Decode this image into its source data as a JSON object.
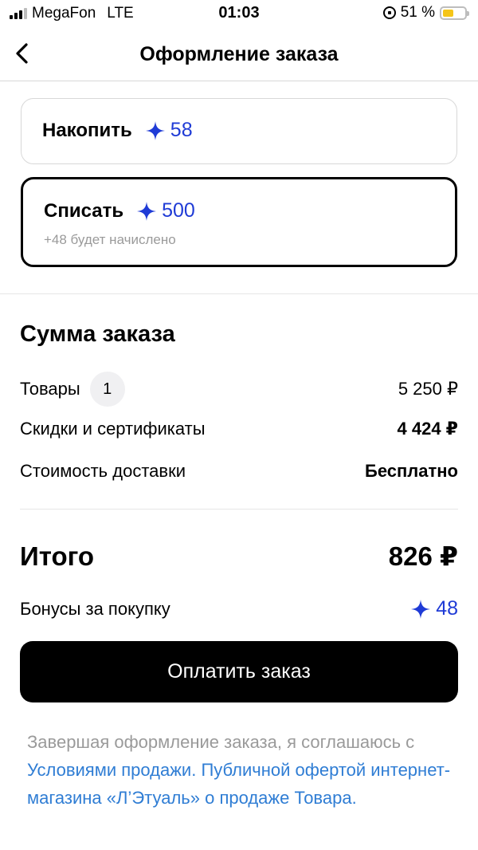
{
  "status_bar": {
    "carrier": "MegaFon",
    "network": "LTE",
    "time": "01:03",
    "battery": "51 %",
    "battery_level": 0.51
  },
  "header": {
    "title": "Оформление заказа",
    "back_icon": "chevron-left-icon"
  },
  "bonus_options": {
    "accumulate": {
      "label": "Накопить",
      "amount": "58"
    },
    "spend": {
      "label": "Списать",
      "amount": "500",
      "note": "+48 будет начислено",
      "selected": true
    }
  },
  "summary": {
    "title": "Сумма заказа",
    "goods_label": "Товары",
    "goods_count": "1",
    "goods_value": "5 250 ₽",
    "discounts_label": "Скидки и сертификаты",
    "discounts_value": "4 424 ₽",
    "delivery_label": "Стоимость доставки",
    "delivery_value": "Бесплатно",
    "total_label": "Итого",
    "total_value": "826 ₽",
    "bonus_label": "Бонусы за покупку",
    "bonus_value": "48"
  },
  "pay_button": {
    "label": "Оплатить заказ"
  },
  "legal": {
    "prefix": "Завершая оформление заказа, я соглашаюсь с ",
    "link1": "Условиями продажи.",
    "link2": "Публичной офертой интернет-магазина «Л’Этуаль» о продаже Товара."
  },
  "colors": {
    "accent": "#1f3bd6",
    "link": "#2f7dd4",
    "muted": "#9a9a9a",
    "battery": "#f5c518"
  }
}
